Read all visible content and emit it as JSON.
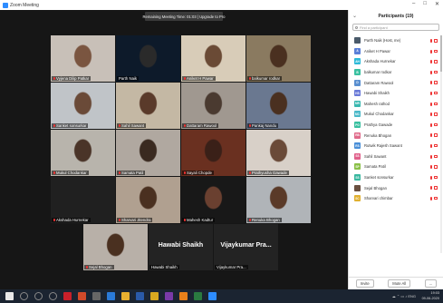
{
  "window": {
    "title": "Zoom Meeting",
    "minimize_glyph": "–",
    "maximize_glyph": "□",
    "close_glyph": "✕"
  },
  "banner": {
    "text": "Remaining Meeting Time: 01:03 | Upgrade to Pro"
  },
  "tiles": [
    {
      "name": "Vyjena Dilip Patkar",
      "bg": "#c8c0b8",
      "face": "#7a5540",
      "muted": true
    },
    {
      "name": "Parth Naik",
      "bg": "#0d1a2a",
      "face": "#2a2a2a",
      "muted": false,
      "active": true
    },
    {
      "name": "Aniket H Pawar",
      "bg": "#d8ccb8",
      "face": "#6a4a35",
      "muted": true
    },
    {
      "name": "Aniket H Pawar",
      "bg": "#c8c4bc",
      "face": "#5a3a28",
      "muted": true
    },
    {
      "name": "balkumar rodkar",
      "bg": "#8a7a60",
      "face": "#4a3020",
      "muted": true
    },
    {
      "name": "Sanket sonsurkar",
      "bg": "#c0c4c8",
      "face": "#6a4a38",
      "muted": true
    },
    {
      "name": "Sahil Sawant",
      "bg": "#c4b8a4",
      "face": "#5a3a2a",
      "muted": true
    },
    {
      "name": "Dattaram Rawool",
      "bg": "#a09890",
      "face": "#4a3a30",
      "muted": true
    },
    {
      "name": "Pankaj Nandu",
      "bg": "#6a7890",
      "face": "#4a3020",
      "muted": true
    },
    {
      "name": "Mukul Chodankar",
      "bg": "#b8b4ac",
      "face": "#4a3428",
      "muted": true
    },
    {
      "name": "Samata Patil",
      "bg": "#b0a8a0",
      "face": "#3a2a20",
      "muted": true
    },
    {
      "name": "Sayali Chopde",
      "bg": "#6a3020",
      "face": "#3a2018",
      "muted": true
    },
    {
      "name": "Prathyusha Gawade",
      "bg": "#d8d0c8",
      "face": "#6a4a38",
      "muted": true
    },
    {
      "name": "Akshada Hurnekar",
      "bg": "#202020",
      "face": "#202020",
      "muted": true
    },
    {
      "name": "Sharvari Jitendra",
      "bg": "#b0a090",
      "face": "#4a3020",
      "muted": true
    },
    {
      "name": "Mahesh Kadtur",
      "bg": "#181818",
      "face": "#6a4030",
      "muted": true
    },
    {
      "name": "Renuka Bhogan",
      "bg": "#b0b4b8",
      "face": "#5a3a28",
      "muted": true
    },
    {
      "name": "Sejal Bhogan",
      "bg": "#b8b0a8",
      "face": "#4a3020",
      "muted": true
    },
    {
      "name": "Hawabi Shaikh",
      "big": true
    },
    {
      "name": "Vijaykumar Pra...",
      "big": true
    }
  ],
  "panel": {
    "title": "Participants (19)",
    "collapse_glyph": "⌄",
    "search_placeholder": "Find a participant",
    "participants": [
      {
        "name": "Parth Naik (Host, me)",
        "initials": "",
        "color": "#4a5a6a"
      },
      {
        "name": "Aniket H Pawar",
        "initials": "A",
        "color": "#5a7fd8"
      },
      {
        "name": "Akshada Hurnekar",
        "initials": "AH",
        "color": "#2dbad8"
      },
      {
        "name": "balkumar rodkar",
        "initials": "B",
        "color": "#3ac0a0"
      },
      {
        "name": "Dattaram Rawool",
        "initials": "D",
        "color": "#5a8fd0"
      },
      {
        "name": "Hawabi Shaikh",
        "initials": "HS",
        "color": "#6a7ad8"
      },
      {
        "name": "Mahesh rathod",
        "initials": "MR",
        "color": "#3ab8b0"
      },
      {
        "name": "Mukul Chodankar",
        "initials": "MC",
        "color": "#4ab8c8"
      },
      {
        "name": "Prathya Gawade",
        "initials": "PG",
        "color": "#3ac0a0"
      },
      {
        "name": "Renuka Bhogan",
        "initials": "RB",
        "color": "#e06a8a"
      },
      {
        "name": "Rutwik Rajesh Sawant",
        "initials": "RS",
        "color": "#4a8fd8"
      },
      {
        "name": "Sahil Sawant",
        "initials": "SS",
        "color": "#e0608a"
      },
      {
        "name": "Samata Patil",
        "initials": "SP",
        "color": "#8ac048"
      },
      {
        "name": "Sanket sonsurkar",
        "initials": "SS",
        "color": "#3ab8a0"
      },
      {
        "name": "Sejal Bhogan",
        "initials": "",
        "color": "#6a5040"
      },
      {
        "name": "Sharvari chimbar",
        "initials": "SC",
        "color": "#e0b030"
      }
    ],
    "footer": {
      "invite": "Invite",
      "mute_all": "Mute All",
      "more": "..."
    }
  },
  "taskbar": {
    "icons": [
      {
        "name": "windows-start-icon",
        "color": "#e8e8e8"
      },
      {
        "name": "search-icon",
        "color": "#555"
      },
      {
        "name": "cortana-icon",
        "color": "#555"
      },
      {
        "name": "task-view-icon",
        "color": "#555"
      },
      {
        "name": "acrobat-icon",
        "color": "#c8202a"
      },
      {
        "name": "powerpoint-icon",
        "color": "#d04a2a"
      },
      {
        "name": "settings-icon",
        "color": "#666"
      },
      {
        "name": "app-icon",
        "color": "#2a7ad8"
      },
      {
        "name": "file-explorer-icon",
        "color": "#e8b030"
      },
      {
        "name": "word-icon",
        "color": "#2a5aa8"
      },
      {
        "name": "chrome-icon",
        "color": "#d8a820"
      },
      {
        "name": "onenote-icon",
        "color": "#7a3aa8"
      },
      {
        "name": "vlc-icon",
        "color": "#e8801a"
      },
      {
        "name": "excel-icon",
        "color": "#2a7a40"
      },
      {
        "name": "zoom-taskbar-icon",
        "color": "#2d8cff"
      }
    ],
    "tray_text": "☁ ⌃ ▭ ♪ ENG",
    "time": "19:03",
    "date": "09-06-2020"
  }
}
